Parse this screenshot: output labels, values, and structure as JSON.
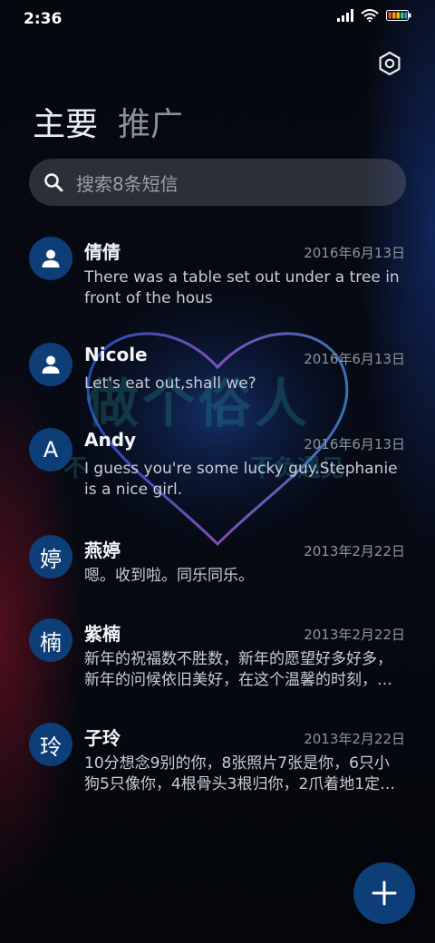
{
  "status_bar": {
    "time": "2:36"
  },
  "tabs": {
    "primary": "主要",
    "secondary": "推广"
  },
  "search": {
    "placeholder": "搜索8条短信"
  },
  "wallpaper": {
    "watermark_main": "做个俗人",
    "watermark_left": "不",
    "watermark_right": "不负遇见"
  },
  "colors": {
    "accent": "#0e3e78",
    "background": "#05070d",
    "secondary_text": "#8d939c"
  },
  "messages": [
    {
      "avatar": "person-icon",
      "avatar_text": "",
      "name": "倩倩",
      "date": "2016年6月13日",
      "preview_lines": [
        "There was a table set out under a tree in",
        "front of the hous"
      ]
    },
    {
      "avatar": "person-icon",
      "avatar_text": "",
      "name": "Nicole",
      "date": "2016年6月13日",
      "preview_lines": [
        "Let's eat out,shall we?"
      ]
    },
    {
      "avatar": "letter",
      "avatar_text": "A",
      "name": "Andy",
      "date": "2016年6月13日",
      "preview_lines": [
        "I guess you're some lucky guy.Stephanie",
        "is a nice girl."
      ]
    },
    {
      "avatar": "letter",
      "avatar_text": "婷",
      "name": "燕婷",
      "date": "2013年2月22日",
      "preview_lines": [
        "嗯。收到啦。同乐同乐。"
      ]
    },
    {
      "avatar": "letter",
      "avatar_text": "楠",
      "name": "紫楠",
      "date": "2013年2月22日",
      "preview_lines": [
        "新年的祝福数不胜数，新年的愿望好多好多，",
        "新年的问候依旧美好，在这个温馨的时刻，…"
      ]
    },
    {
      "avatar": "letter",
      "avatar_text": "玲",
      "name": "子玲",
      "date": "2013年2月22日",
      "preview_lines": [
        "10分想念9别的你，8张照片7张是你，6只小",
        "狗5只像你，4根骨头3根归你，2爪着地1定…"
      ]
    }
  ]
}
